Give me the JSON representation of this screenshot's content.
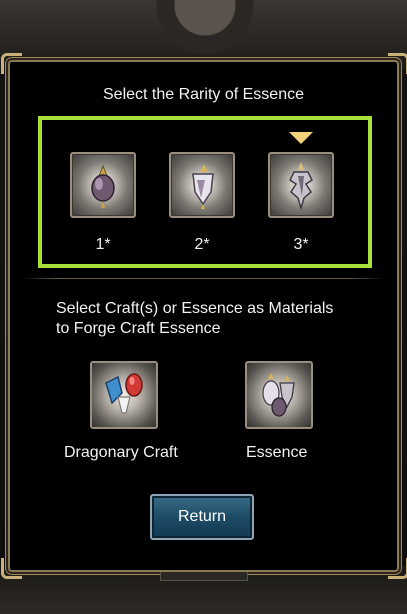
{
  "title": "Select the Rarity of Essence",
  "rarity_slots": [
    {
      "label": "1*",
      "icon": "essence-1star-icon"
    },
    {
      "label": "2*",
      "icon": "essence-2star-icon"
    },
    {
      "label": "3*",
      "icon": "essence-3star-icon"
    }
  ],
  "selected_rarity_index": 2,
  "materials_prompt_line1": "Select Craft(s) or Essence as Materials",
  "materials_prompt_line2": "to Forge Craft Essence",
  "materials": [
    {
      "label": "Dragonary Craft",
      "icon": "dragonary-craft-icon"
    },
    {
      "label": "Essence",
      "icon": "essence-icon"
    }
  ],
  "return_label": "Return",
  "colors": {
    "highlight": "#a6e23a",
    "selector": "#f2d27a",
    "button": "#1d4b66"
  }
}
